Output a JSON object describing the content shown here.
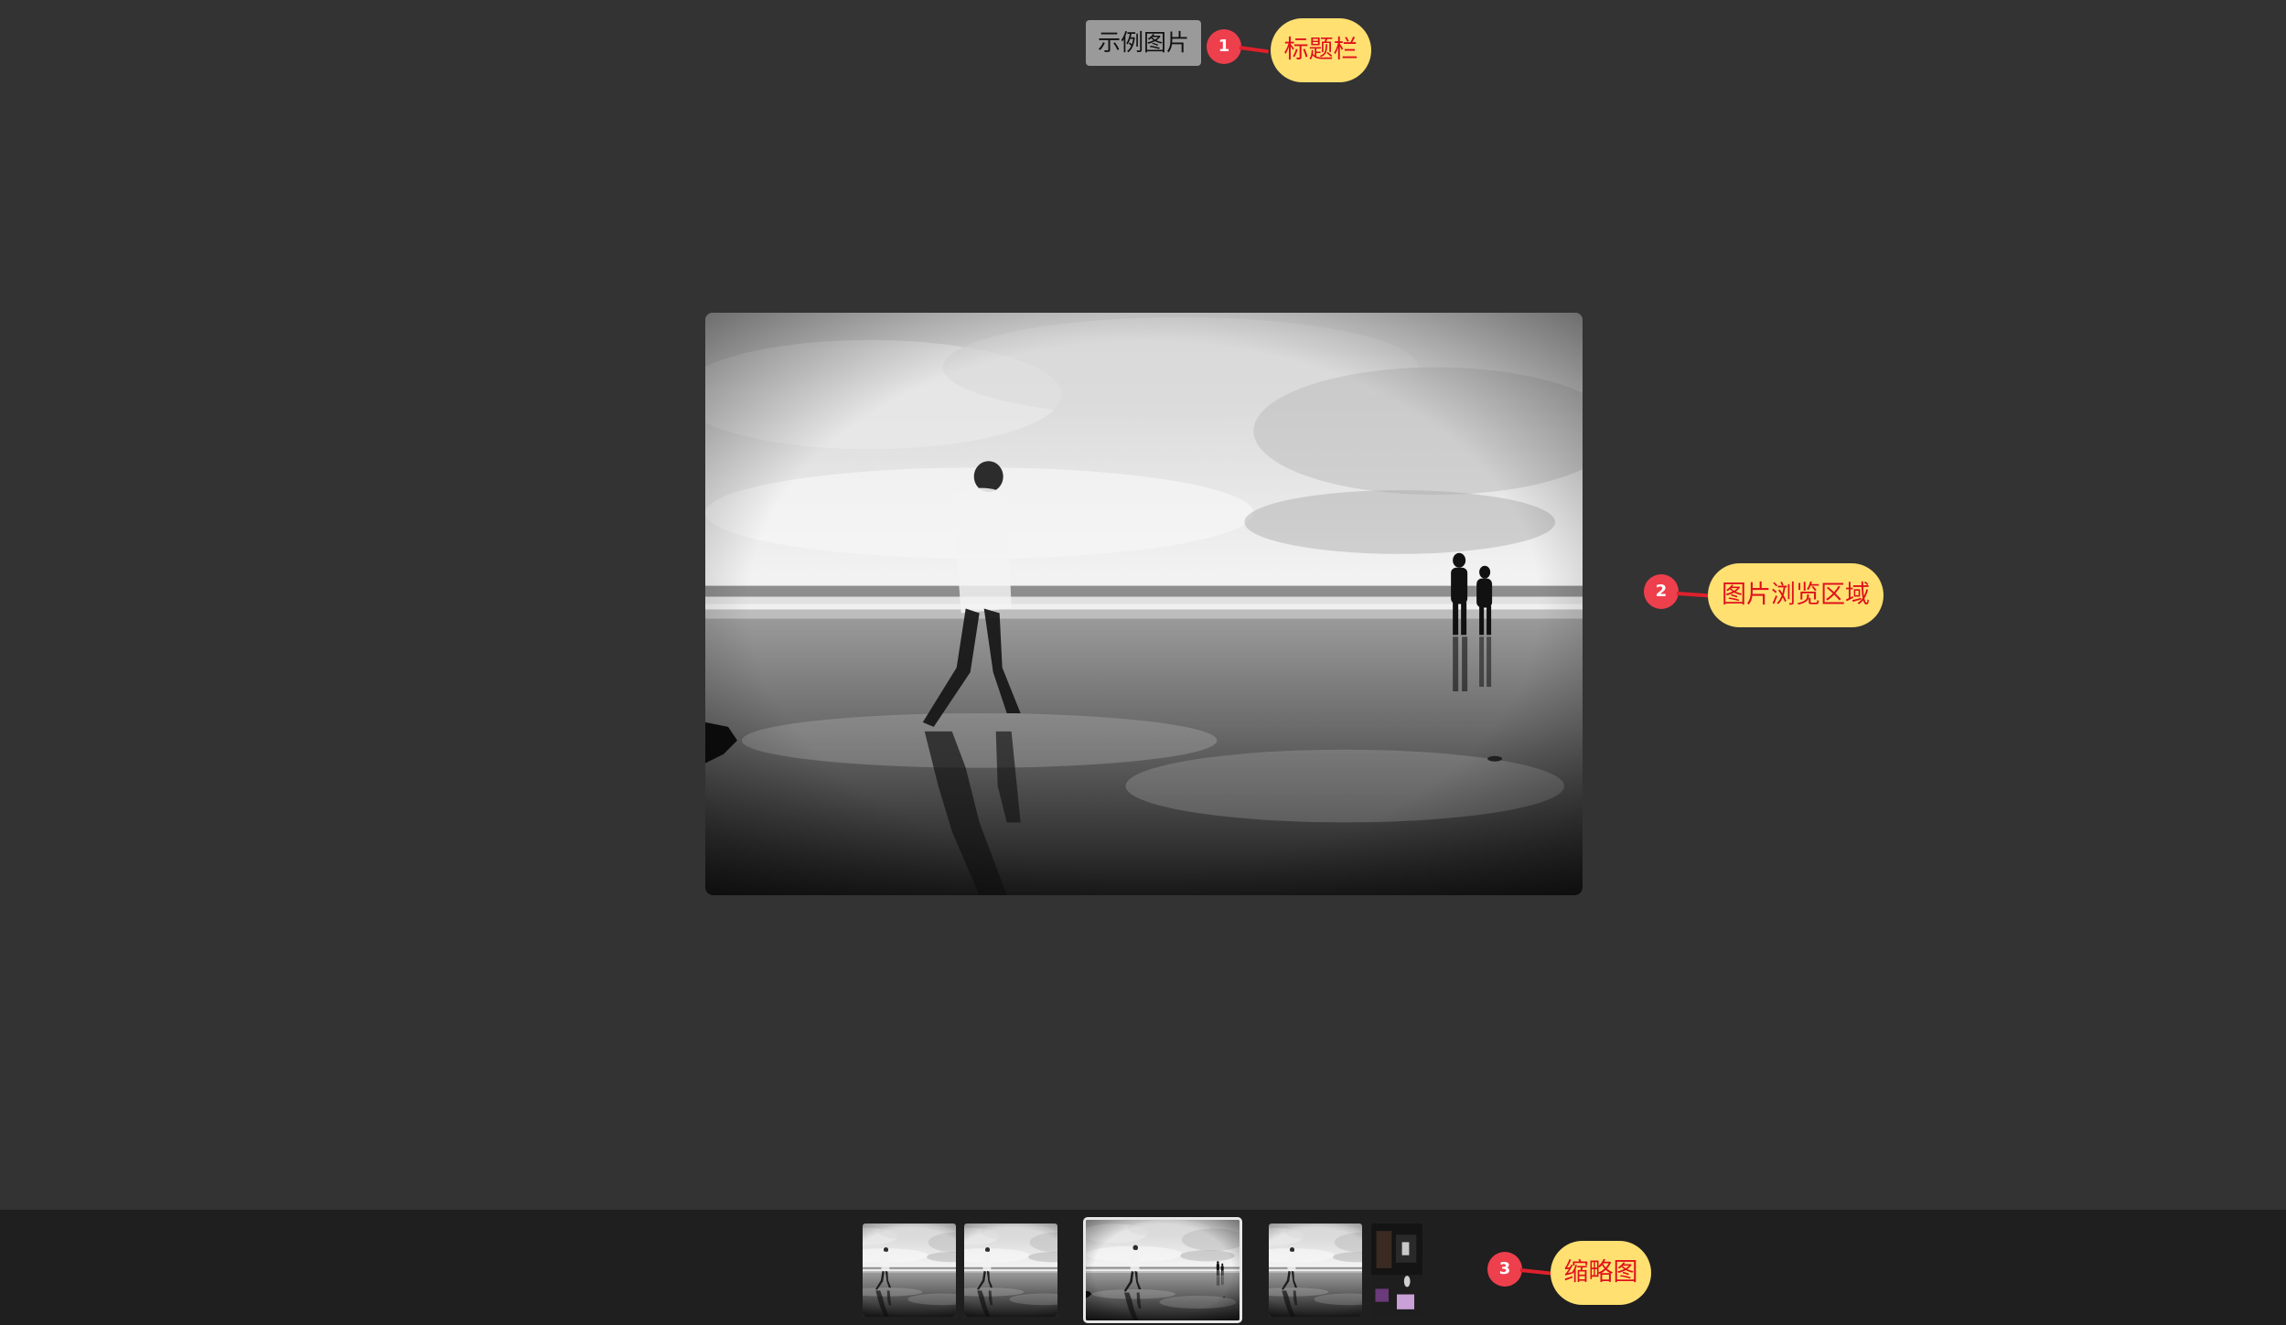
{
  "title_bar": {
    "title": "示例图片"
  },
  "annotations": [
    {
      "number": "1",
      "label": "标题栏"
    },
    {
      "number": "2",
      "label": "图片浏览区域"
    },
    {
      "number": "3",
      "label": "缩略图"
    }
  ],
  "viewer": {
    "image": "black-and-white beach photo with walking figure"
  },
  "thumbnails": {
    "count": 5,
    "active_index": 2
  },
  "colors": {
    "page_background": "#333333",
    "strip_background": "#1f1f1f",
    "title_chip": "#9a9a9a",
    "callout_badge": "#ee3f4d",
    "callout_bubble": "#ffe071",
    "callout_text": "#e0101c"
  }
}
